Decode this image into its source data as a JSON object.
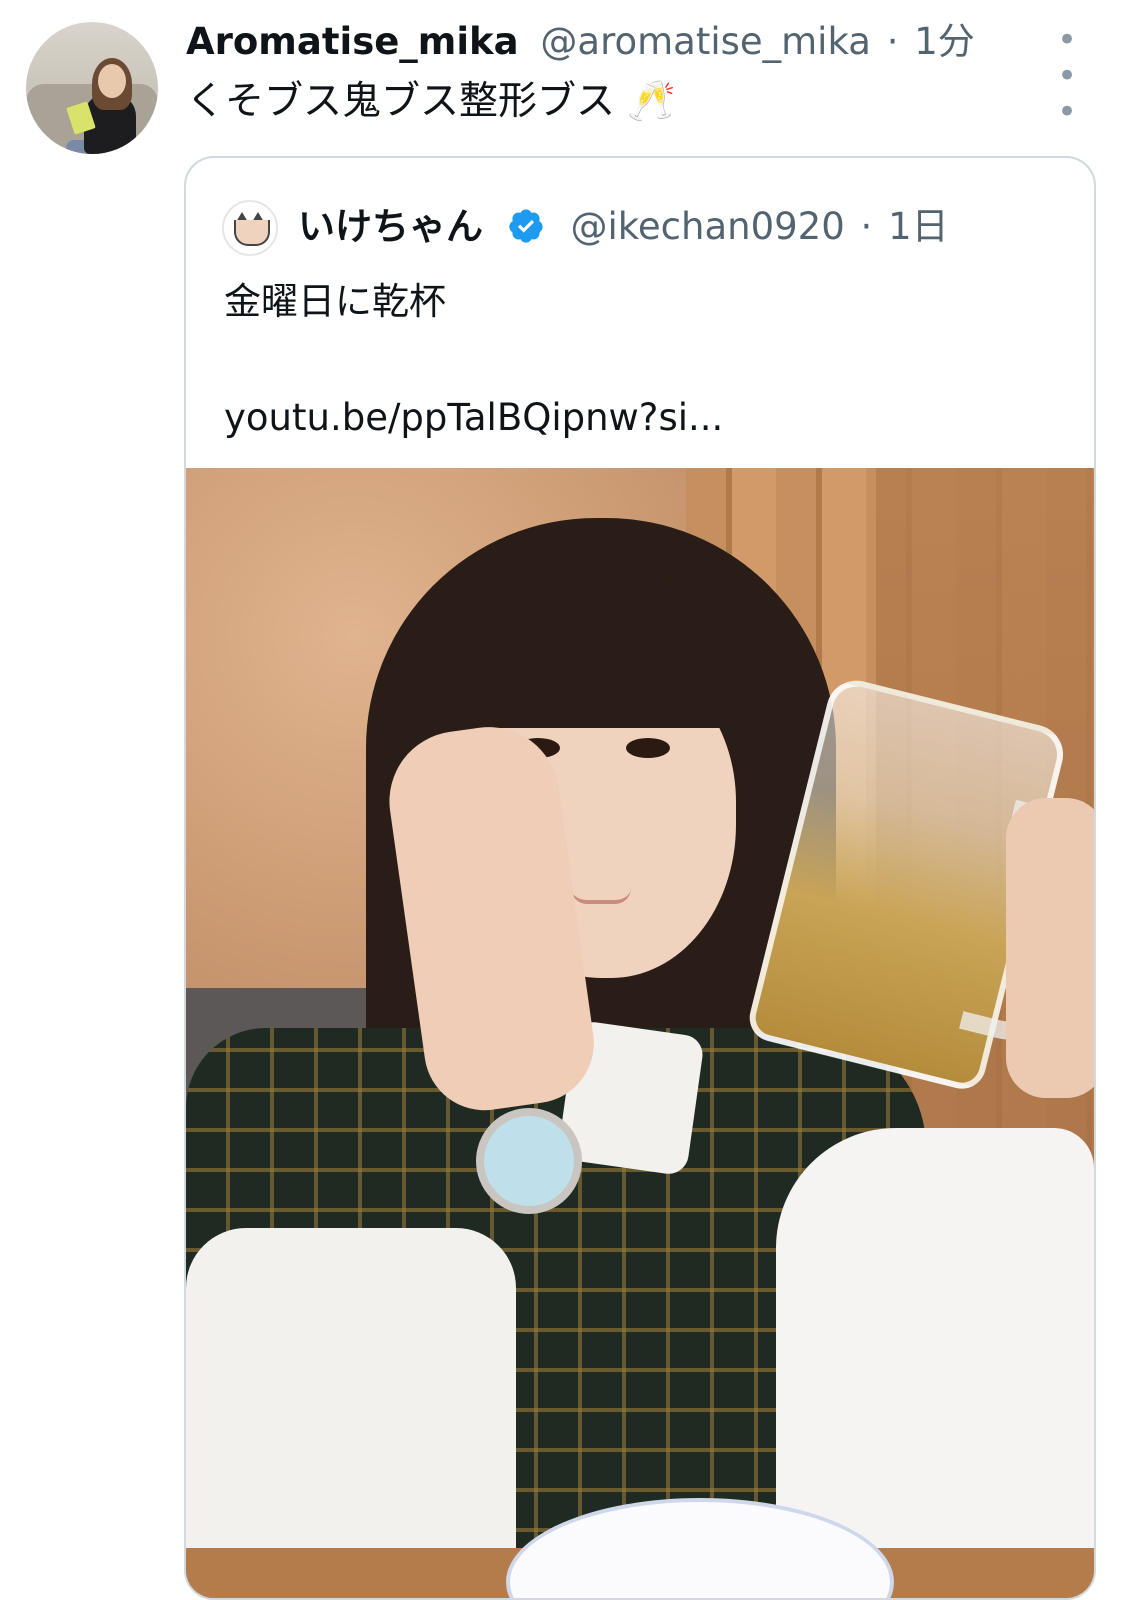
{
  "tweet": {
    "display_name": "Aromatise_mika",
    "handle": "@aromatise_mika",
    "separator": "·",
    "time": "1分",
    "text": "くそブス鬼ブス整形ブス 🥂",
    "more_icon": "more-horizontal-icon"
  },
  "quoted_tweet": {
    "display_name": "いけちゃん",
    "verified": true,
    "verified_color": "#1d9bf0",
    "handle": "@ikechan0920",
    "separator": "·",
    "time": "1日",
    "text": "金曜日に乾杯",
    "link": "youtu.be/ppTalBQipnw?si..."
  },
  "colors": {
    "text_primary": "#0f1419",
    "text_secondary": "#536471",
    "border": "#cfd9de"
  }
}
